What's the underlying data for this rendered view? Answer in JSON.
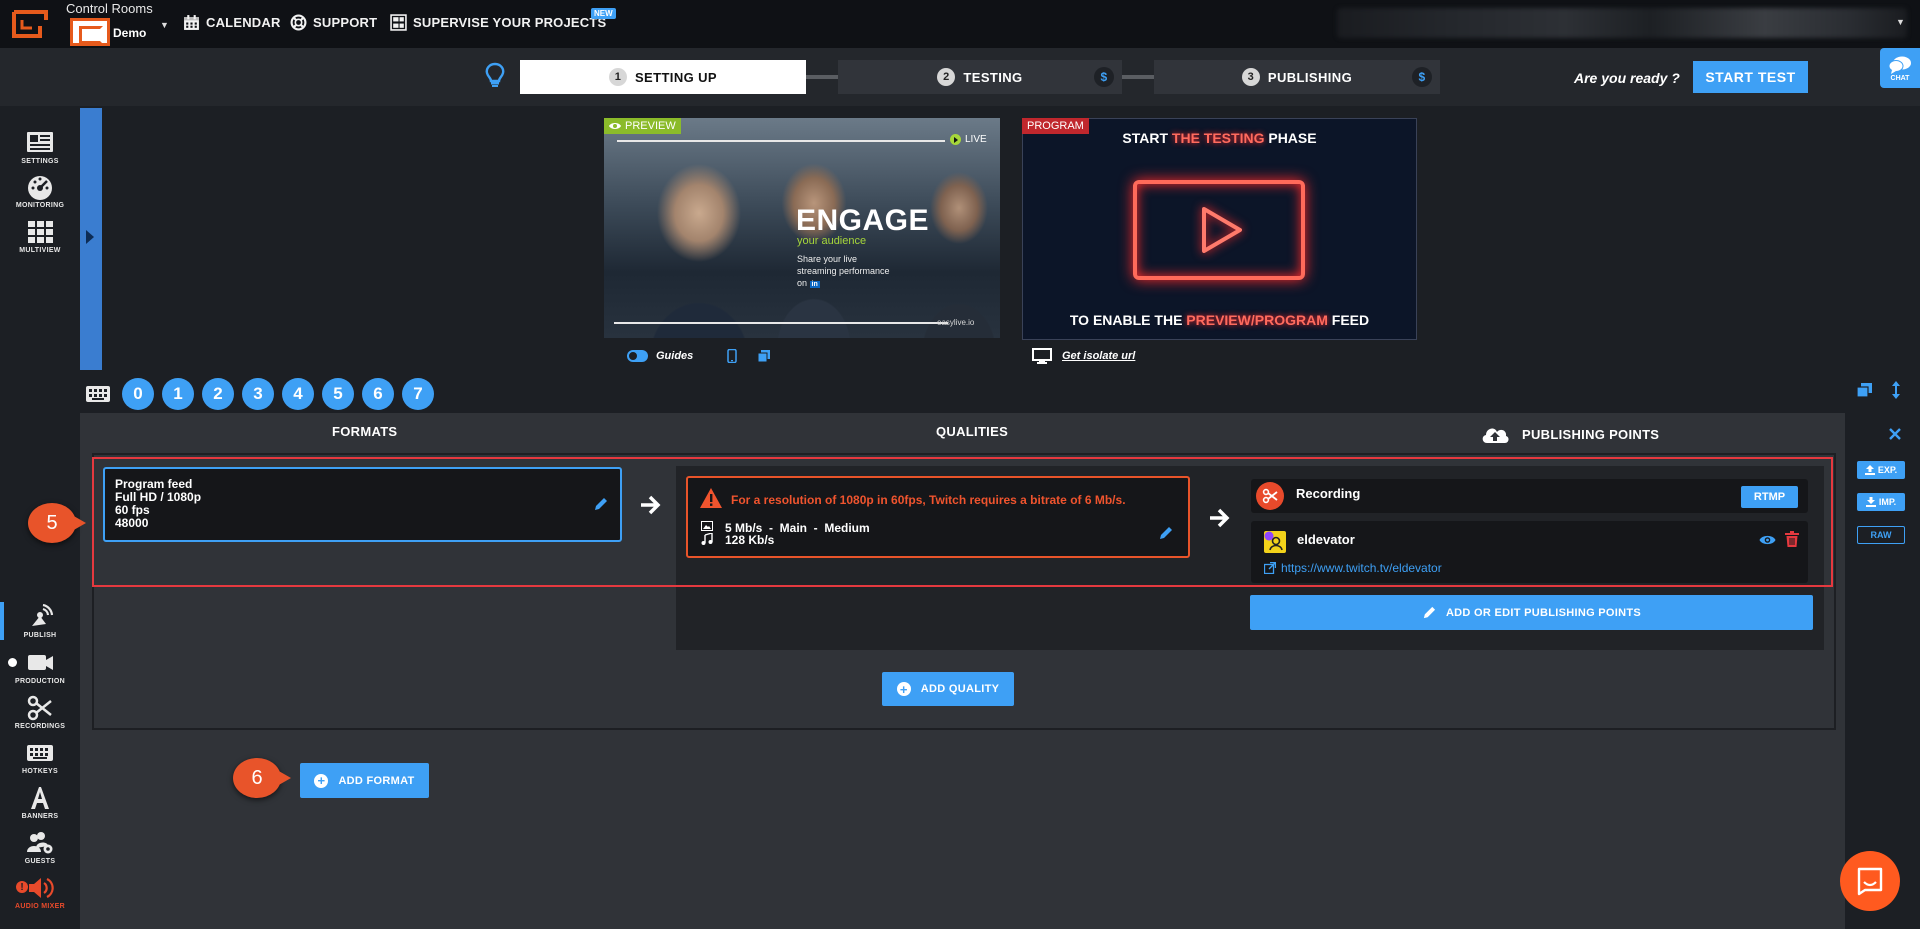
{
  "topbar": {
    "room_title": "Control Rooms",
    "room_name": "Demo",
    "nav": [
      {
        "label": "CALENDAR",
        "icon": "calendar-icon"
      },
      {
        "label": "SUPPORT",
        "icon": "lifebuoy-icon"
      },
      {
        "label": "SUPERVISE YOUR PROJECTS",
        "icon": "dashboard-icon"
      }
    ],
    "new_badge": "NEW"
  },
  "steps": [
    {
      "num": "1",
      "label": "SETTING UP",
      "active": true
    },
    {
      "num": "2",
      "label": "TESTING",
      "paid": "$"
    },
    {
      "num": "3",
      "label": "PUBLISHING",
      "paid": "$"
    }
  ],
  "ready_text": "Are you ready ?",
  "start_test_label": "START TEST",
  "chat_label": "CHAT",
  "sidebar": {
    "top": [
      {
        "label": "SETTINGS",
        "icon": "settings-icon"
      },
      {
        "label": "MONITORING",
        "icon": "gauge-icon"
      },
      {
        "label": "MULTIVIEW",
        "icon": "grid-icon"
      }
    ],
    "bottom": [
      {
        "label": "PUBLISH",
        "icon": "broadcast-icon",
        "active": true
      },
      {
        "label": "PRODUCTION",
        "icon": "camera-icon"
      },
      {
        "label": "RECORDINGS",
        "icon": "scissors-icon"
      },
      {
        "label": "HOTKEYS",
        "icon": "keyboard-icon"
      },
      {
        "label": "BANNERS",
        "icon": "letter-a-icon"
      },
      {
        "label": "GUESTS",
        "icon": "users-gear-icon"
      },
      {
        "label": "AUDIO MIXER",
        "icon": "speaker-icon"
      }
    ]
  },
  "preview": {
    "label": "PREVIEW",
    "live": "LIVE",
    "headline": "ENGAGE",
    "sub": "your audience",
    "desc": "Share your live streaming performance on",
    "brand": "easylive.io",
    "guides_label": "Guides"
  },
  "program": {
    "label": "PROGRAM",
    "title_a": "START ",
    "title_hl": "THE TESTING",
    "title_b": " PHASE",
    "foot_a": "TO ENABLE THE ",
    "foot_hl": "PREVIEW/PROGRAM",
    "foot_b": " FEED",
    "isolate_label": "Get isolate url"
  },
  "hotkey_numbers": [
    "0",
    "1",
    "2",
    "3",
    "4",
    "5",
    "6",
    "7"
  ],
  "columns": {
    "formats": "FORMATS",
    "qualities": "QUALITIES",
    "publishing": "PUBLISHING POINTS"
  },
  "format_card": {
    "name": "Program feed",
    "resolution": "Full HD / 1080p",
    "fps": "60 fps",
    "audio_rate": "48000"
  },
  "quality_card": {
    "warning": "For a resolution of 1080p in 60fps, Twitch requires a bitrate of 6 Mb/s.",
    "video": "5 Mb/s  -  Main  -  Medium",
    "audio": "128 Kb/s"
  },
  "publishing": {
    "recording_label": "Recording",
    "recording_type": "RTMP",
    "twitch_name": "eldevator",
    "twitch_url": "https://www.twitch.tv/eldevator",
    "add_edit_label": "ADD OR EDIT PUBLISHING POINTS"
  },
  "add_quality_label": "ADD QUALITY",
  "add_format_label": "ADD FORMAT",
  "callouts": [
    "5",
    "6"
  ],
  "right_tools": {
    "export": "EXP.",
    "import": "IMP.",
    "raw": "RAW"
  },
  "colors": {
    "accent": "#3ea0f5",
    "warning": "#e8542a",
    "highlight_frame": "#e5393f",
    "preview_tag": "#8bbb2a",
    "program_tag": "#c0272d"
  }
}
